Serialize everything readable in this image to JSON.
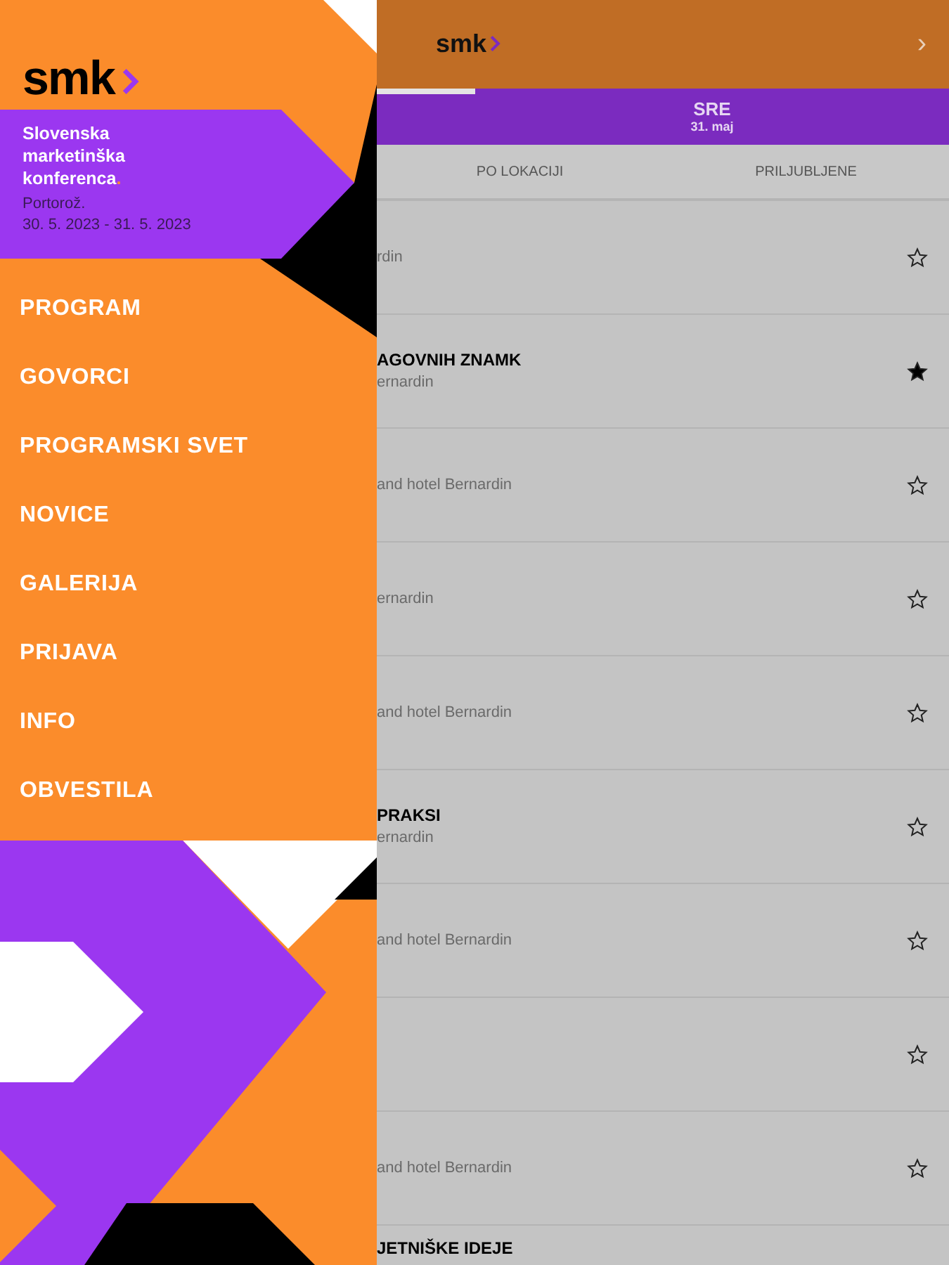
{
  "drawer": {
    "logo": "smk",
    "event": {
      "title": "Slovenska marketinška konferenca",
      "title_end": ".",
      "place": "Portorož.",
      "dates": "30. 5. 2023 - 31. 5. 2023"
    },
    "menu": [
      "PROGRAM",
      "GOVORCI",
      "PROGRAMSKI SVET",
      "NOVICE",
      "GALERIJA",
      "PRIJAVA",
      "INFO",
      "OBVESTILA"
    ]
  },
  "header": {
    "logo": "smk",
    "next": "›"
  },
  "day_tabs": [
    {
      "day": "SRE",
      "date": "31. maj",
      "selected": false
    }
  ],
  "filter_tabs": [
    "PO LOKACIJI",
    "PRILJUBLJENE"
  ],
  "sessions": [
    {
      "location": "rdin",
      "favorite": false
    },
    {
      "title": "AGOVNIH ZNAMK",
      "location": "ernardin",
      "favorite": true
    },
    {
      "location": "and hotel Bernardin",
      "favorite": false
    },
    {
      "location": "ernardin",
      "favorite": false
    },
    {
      "location": "and hotel Bernardin",
      "favorite": false
    },
    {
      "title": "PRAKSI",
      "location": "ernardin",
      "favorite": false
    },
    {
      "location": "and hotel Bernardin",
      "favorite": false
    },
    {
      "favorite": false
    },
    {
      "location": "and hotel Bernardin",
      "favorite": false
    }
  ],
  "last_session": {
    "title": "JETNIŠKE IDEJE"
  }
}
